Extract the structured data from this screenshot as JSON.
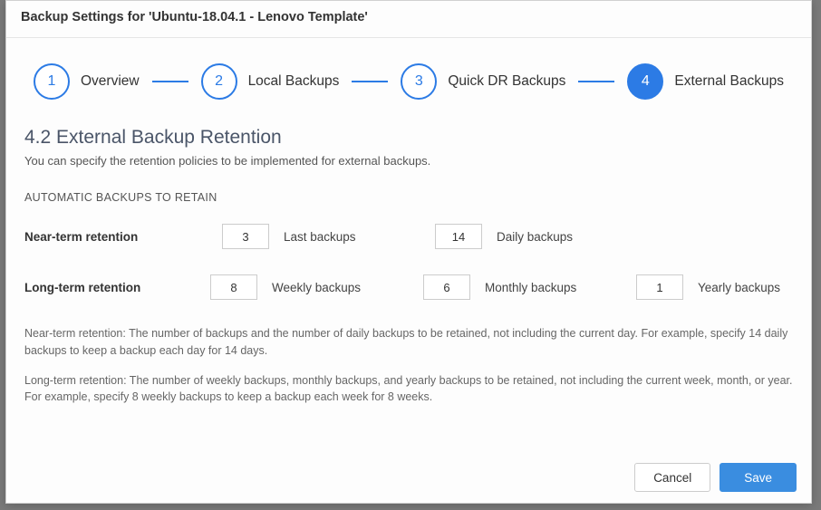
{
  "modal": {
    "title": "Backup Settings for 'Ubuntu-18.04.1 - Lenovo Template'"
  },
  "stepper": {
    "steps": [
      {
        "num": "1",
        "label": "Overview"
      },
      {
        "num": "2",
        "label": "Local Backups"
      },
      {
        "num": "3",
        "label": "Quick DR Backups"
      },
      {
        "num": "4",
        "label": "External Backups"
      }
    ]
  },
  "section": {
    "title": "4.2 External Backup Retention",
    "subtitle": "You can specify the retention policies to be implemented for external backups.",
    "group_label": "AUTOMATIC BACKUPS TO RETAIN"
  },
  "near_term": {
    "row_label": "Near-term retention",
    "last": {
      "value": "3",
      "label": "Last backups"
    },
    "daily": {
      "value": "14",
      "label": "Daily backups"
    }
  },
  "long_term": {
    "row_label": "Long-term retention",
    "weekly": {
      "value": "8",
      "label": "Weekly backups"
    },
    "monthly": {
      "value": "6",
      "label": "Monthly backups"
    },
    "yearly": {
      "value": "1",
      "label": "Yearly backups"
    }
  },
  "help": {
    "near": "Near-term retention: The number of backups and the number of daily backups to be retained, not including the current day. For example, specify 14 daily backups to keep a backup each day for 14 days.",
    "long": "Long-term retention: The number of weekly backups, monthly backups, and yearly backups to be retained, not including the current week, month, or year. For example, specify 8 weekly backups to keep a backup each week for 8 weeks."
  },
  "buttons": {
    "cancel": "Cancel",
    "save": "Save"
  }
}
